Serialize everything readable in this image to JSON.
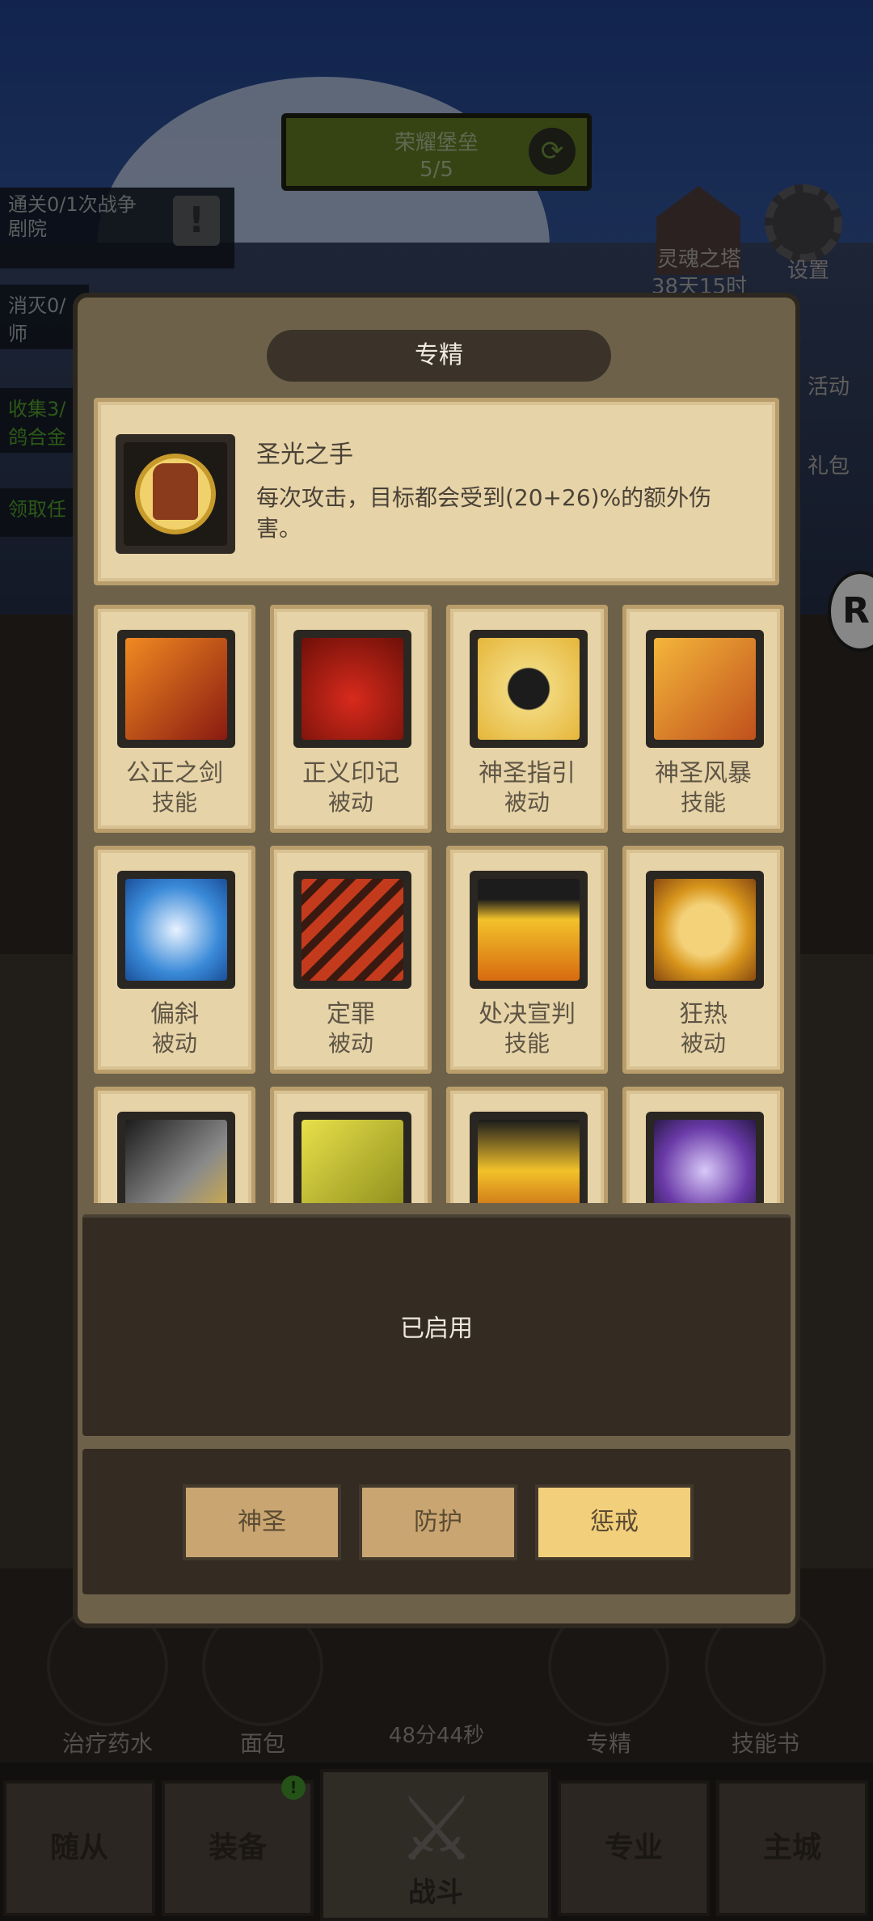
{
  "top_banner": {
    "title": "荣耀堡垒",
    "progress": "5/5"
  },
  "quests": [
    {
      "text": "通关0/1次战争剧院"
    },
    {
      "text": "消灭0/"
    },
    {
      "text": "师"
    },
    {
      "text": "收集3/"
    },
    {
      "text": "鸽合金"
    },
    {
      "text": "领取任"
    }
  ],
  "side": {
    "soul_tower": "灵魂之塔",
    "tower_time": "38天15时",
    "settings": "设置",
    "activity": "活动",
    "gift": "礼包"
  },
  "modal": {
    "title": "专精",
    "selected": {
      "name": "圣光之手",
      "description": "每次攻击，目标都会受到(20+26)%的额外伤害。"
    },
    "skills": [
      {
        "name": "公正之剑",
        "type": "技能"
      },
      {
        "name": "正义印记",
        "type": "被动"
      },
      {
        "name": "神圣指引",
        "type": "被动"
      },
      {
        "name": "神圣风暴",
        "type": "技能"
      },
      {
        "name": "偏斜",
        "type": "被动"
      },
      {
        "name": "定罪",
        "type": "被动"
      },
      {
        "name": "处决宣判",
        "type": "技能"
      },
      {
        "name": "狂热",
        "type": "被动"
      },
      {
        "name": "",
        "type": ""
      },
      {
        "name": "",
        "type": ""
      },
      {
        "name": "",
        "type": ""
      },
      {
        "name": "",
        "type": ""
      }
    ],
    "status": "已启用",
    "tabs": [
      "神圣",
      "防护",
      "惩戒"
    ],
    "active_tab": "惩戒"
  },
  "bottom_icons": [
    "治疗药水",
    "面包",
    "专精",
    "技能书"
  ],
  "timer": "48分44秒",
  "nav": {
    "followers": "随从",
    "equipment": "装备",
    "fight": "战斗",
    "profession": "专业",
    "city": "主城"
  },
  "colors": {
    "parchment": "#e6d3a7",
    "panel": "#6e6149",
    "active_tab": "#f2cf7b"
  }
}
